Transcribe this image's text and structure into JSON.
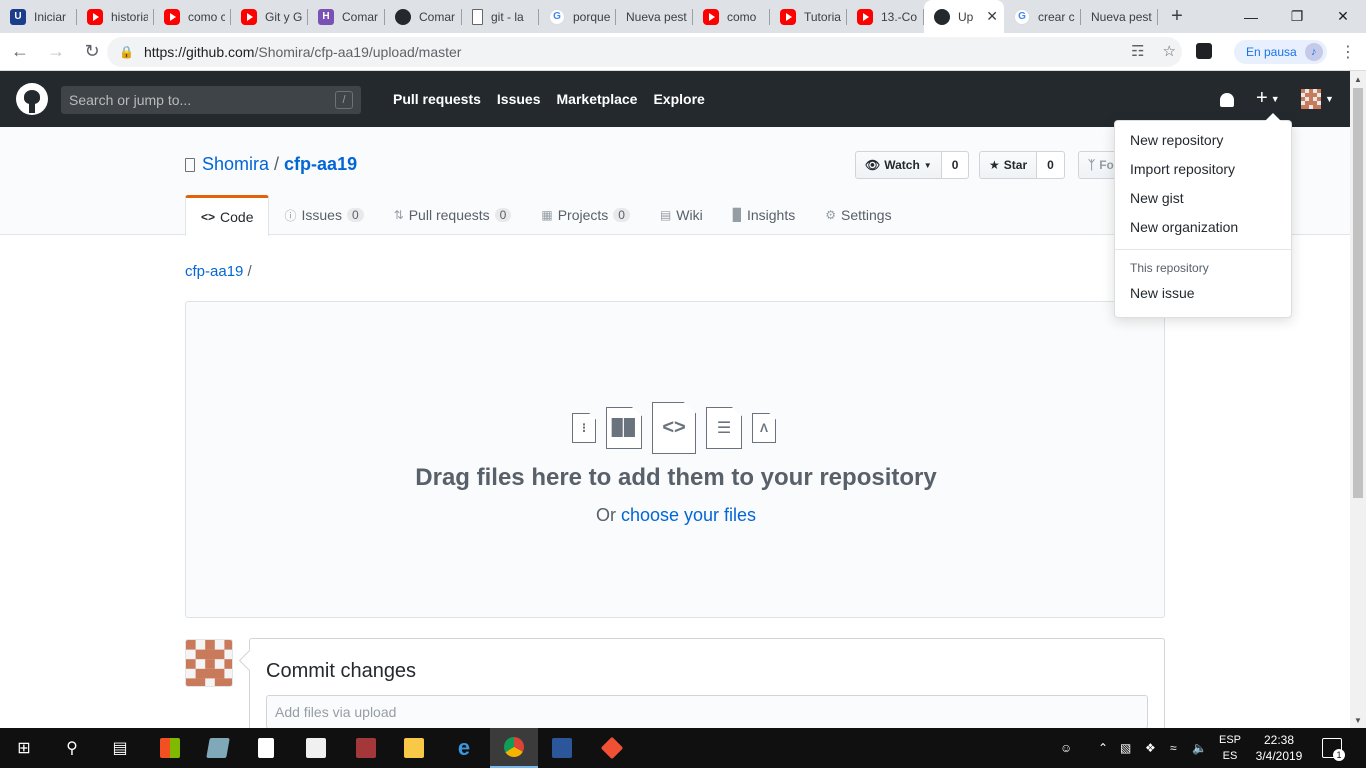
{
  "browser": {
    "tabs": [
      {
        "title": "Iniciar",
        "favicon": "u-icon",
        "active": false
      },
      {
        "title": "historia",
        "favicon": "youtube-icon",
        "active": false
      },
      {
        "title": "como c",
        "favicon": "youtube-icon",
        "active": false
      },
      {
        "title": "Git y G",
        "favicon": "youtube-icon",
        "active": false
      },
      {
        "title": "Comar",
        "favicon": "hackmd-icon",
        "active": false
      },
      {
        "title": "Comar",
        "favicon": "github-icon",
        "active": false
      },
      {
        "title": "git - la",
        "favicon": "document-icon",
        "active": false
      },
      {
        "title": "porque",
        "favicon": "google-icon",
        "active": false
      },
      {
        "title": "Nueva pest",
        "favicon": "none",
        "active": false
      },
      {
        "title": "como",
        "favicon": "youtube-icon",
        "active": false
      },
      {
        "title": "Tutoria",
        "favicon": "youtube-icon",
        "active": false
      },
      {
        "title": "13.-Co",
        "favicon": "youtube-icon",
        "active": false
      },
      {
        "title": "Up",
        "favicon": "github-icon",
        "active": true
      },
      {
        "title": "crear c",
        "favicon": "google-icon",
        "active": false
      },
      {
        "title": "Nueva pest",
        "favicon": "none",
        "active": false
      }
    ],
    "new_tab": "+",
    "url_host": "https://github.com",
    "url_path": "/Shomira/cfp-aa19/upload/master",
    "profile_label": "En pausa"
  },
  "github": {
    "search_placeholder": "Search or jump to...",
    "search_key": "/",
    "nav": [
      "Pull requests",
      "Issues",
      "Marketplace",
      "Explore"
    ],
    "plus": "+",
    "repo_owner": "Shomira",
    "repo_sep": "/",
    "repo_name": "cfp-aa19",
    "watch_label": "Watch",
    "watch_count": "0",
    "star_label": "Star",
    "star_count": "0",
    "fork_label": "Fork",
    "tabs": {
      "code": "Code",
      "issues": "Issues",
      "issues_count": "0",
      "pulls": "Pull requests",
      "pulls_count": "0",
      "projects": "Projects",
      "projects_count": "0",
      "wiki": "Wiki",
      "insights": "Insights",
      "settings": "Settings"
    },
    "breadcrumb_repo": "cfp-aa19",
    "breadcrumb_sep": "/",
    "dropzone_title": "Drag files here to add them to your repository",
    "dropzone_or": "Or",
    "dropzone_link": "choose your files",
    "commit_title": "Commit changes",
    "commit_placeholder": "Add files via upload",
    "dropdown": {
      "items": [
        "New repository",
        "Import repository",
        "New gist",
        "New organization"
      ],
      "section_header": "This repository",
      "section_items": [
        "New issue"
      ]
    }
  },
  "taskbar": {
    "lang_top": "ESP",
    "lang_bottom": "ES",
    "time": "22:38",
    "date": "3/4/2019",
    "notification_count": "1"
  }
}
